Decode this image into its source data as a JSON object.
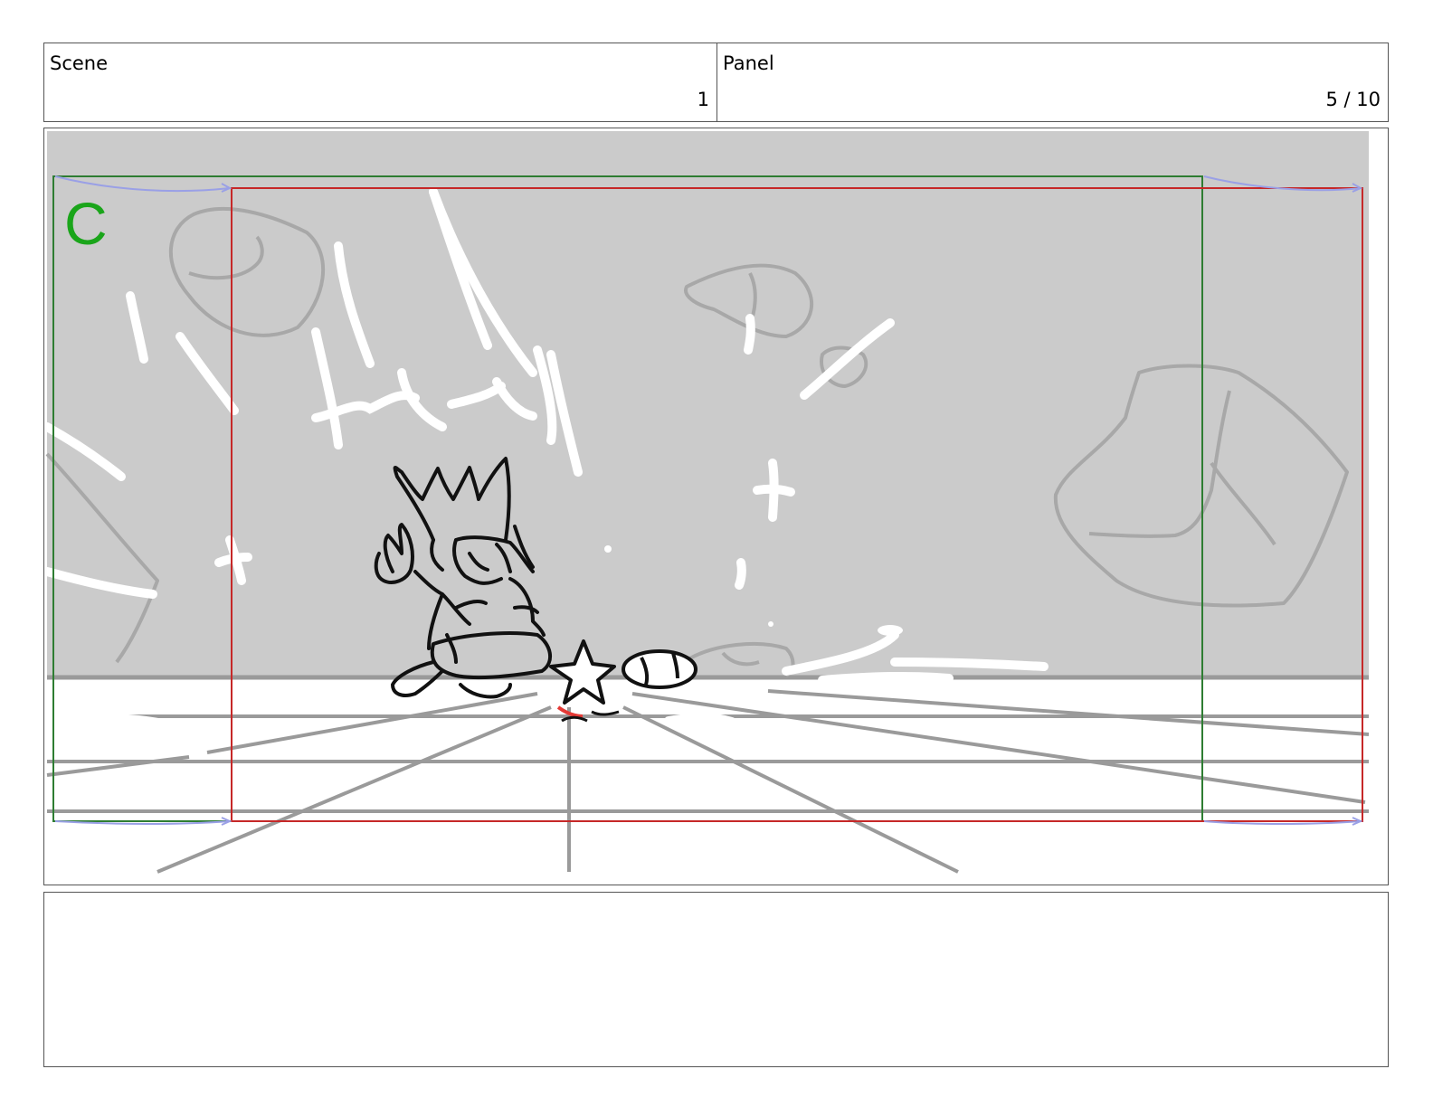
{
  "header": {
    "scene_label": "Scene",
    "scene_value": "1",
    "panel_label": "Panel",
    "panel_value": "5 / 10"
  },
  "artwork": {
    "camera_letter": "C",
    "colors": {
      "background": "#cbcbcb",
      "floor": "#ffffff",
      "sketch_gray": "#9a9a9a",
      "ink": "#111111",
      "camera_start_frame": "#2e7d32",
      "camera_end_frame": "#c62828",
      "camera_letter": "#1aa51a",
      "motion_arrow": "#9aa0e6",
      "accent": "#e53935"
    }
  },
  "notes": {
    "text": ""
  }
}
